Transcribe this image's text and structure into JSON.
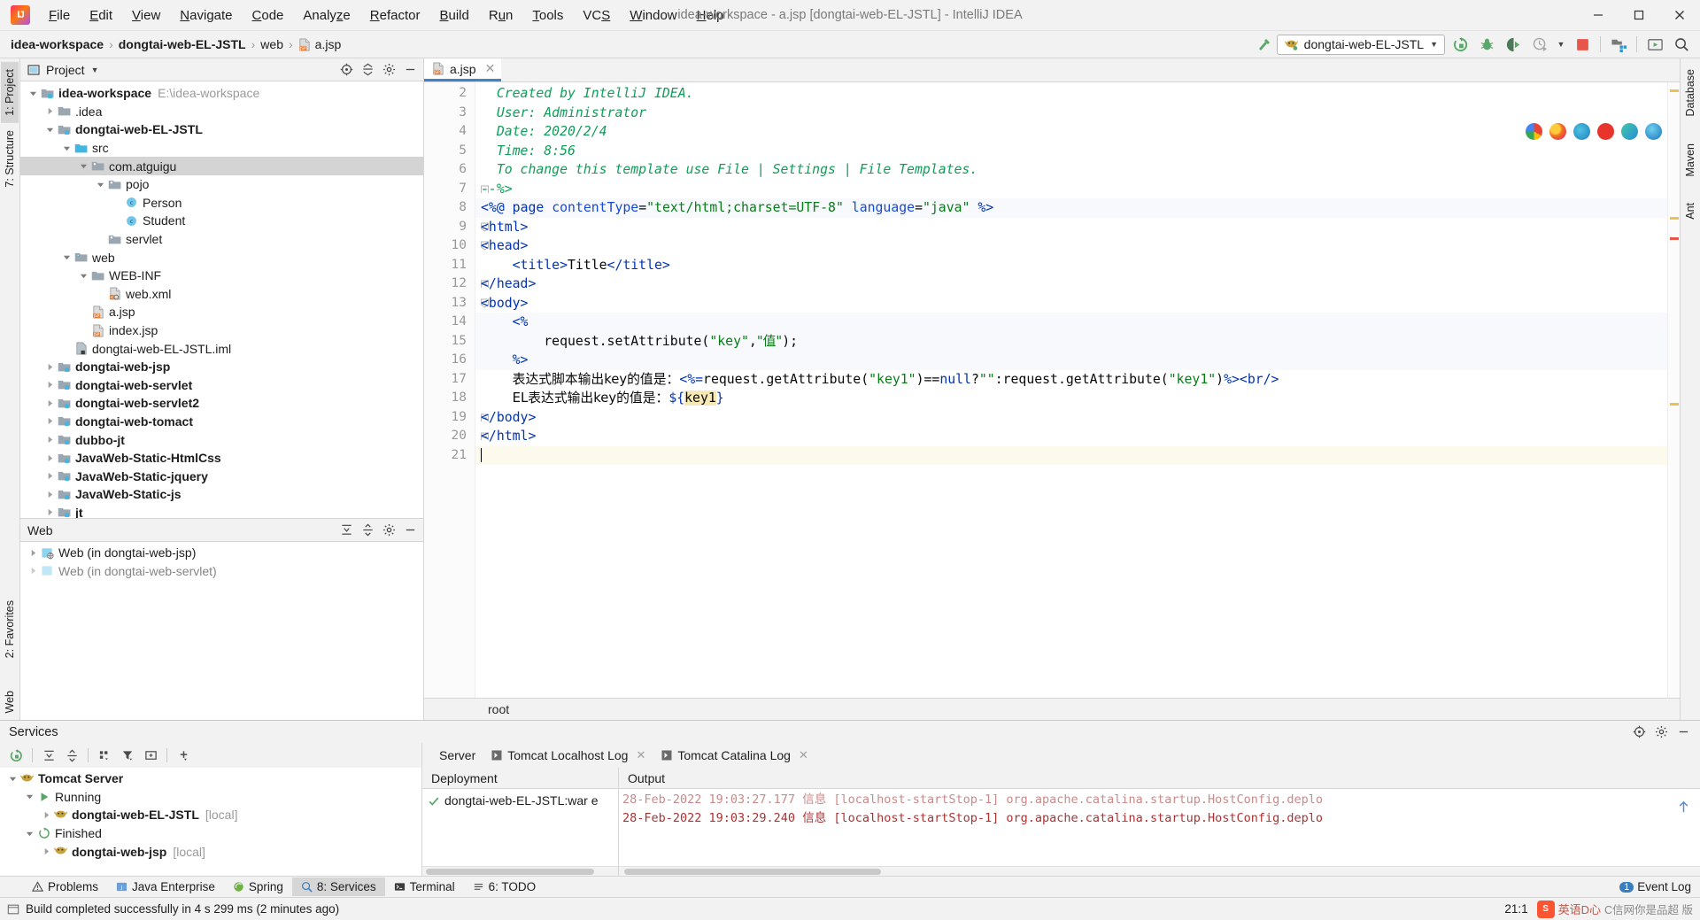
{
  "window": {
    "title": "idea-workspace - a.jsp [dongtai-web-EL-JSTL] - IntelliJ IDEA",
    "minimize": "—",
    "maximize": "❐",
    "close": "✕"
  },
  "menubar": [
    {
      "label": "File",
      "accel": "F"
    },
    {
      "label": "Edit",
      "accel": "E"
    },
    {
      "label": "View",
      "accel": "V"
    },
    {
      "label": "Navigate",
      "accel": "N"
    },
    {
      "label": "Code",
      "accel": "C"
    },
    {
      "label": "Analyze",
      "accel": "z"
    },
    {
      "label": "Refactor",
      "accel": "R"
    },
    {
      "label": "Build",
      "accel": "B"
    },
    {
      "label": "Run",
      "accel": "u"
    },
    {
      "label": "Tools",
      "accel": "T"
    },
    {
      "label": "VCS",
      "accel": "S"
    },
    {
      "label": "Window",
      "accel": "W"
    },
    {
      "label": "Help",
      "accel": "H"
    }
  ],
  "navbar": {
    "crumbs": [
      "idea-workspace",
      "dongtai-web-EL-JSTL",
      "web",
      "a.jsp"
    ],
    "run_config": "dongtai-web-EL-JSTL"
  },
  "left_strip": {
    "project_tab": "1: Project",
    "structure_tab": "7: Structure",
    "favorites_tab": "2: Favorites",
    "web_tab": "Web"
  },
  "right_strip": {
    "database_tab": "Database",
    "maven_tab": "Maven",
    "ant_tab": "Ant"
  },
  "project_panel": {
    "header": "Project",
    "tree": [
      {
        "depth": 0,
        "arrow": "down",
        "icon": "module",
        "label": "idea-workspace",
        "bold": true,
        "path": "E:\\idea-workspace",
        "selected": false
      },
      {
        "depth": 1,
        "arrow": "right",
        "icon": "folder",
        "label": ".idea",
        "bold": false,
        "path": "",
        "selected": false
      },
      {
        "depth": 1,
        "arrow": "down",
        "icon": "module",
        "label": "dongtai-web-EL-JSTL",
        "bold": true,
        "path": "",
        "selected": false
      },
      {
        "depth": 2,
        "arrow": "down",
        "icon": "src",
        "label": "src",
        "bold": false,
        "path": "",
        "selected": false
      },
      {
        "depth": 3,
        "arrow": "down",
        "icon": "package",
        "label": "com.atguigu",
        "bold": false,
        "path": "",
        "selected": true
      },
      {
        "depth": 4,
        "arrow": "down",
        "icon": "package",
        "label": "pojo",
        "bold": false,
        "path": "",
        "selected": false
      },
      {
        "depth": 5,
        "arrow": "none",
        "icon": "class",
        "label": "Person",
        "bold": false,
        "path": "",
        "selected": false
      },
      {
        "depth": 5,
        "arrow": "none",
        "icon": "class",
        "label": "Student",
        "bold": false,
        "path": "",
        "selected": false
      },
      {
        "depth": 4,
        "arrow": "none",
        "icon": "package",
        "label": "servlet",
        "bold": false,
        "path": "",
        "selected": false
      },
      {
        "depth": 2,
        "arrow": "down",
        "icon": "webroot",
        "label": "web",
        "bold": false,
        "path": "",
        "selected": false
      },
      {
        "depth": 3,
        "arrow": "down",
        "icon": "folder",
        "label": "WEB-INF",
        "bold": false,
        "path": "",
        "selected": false
      },
      {
        "depth": 4,
        "arrow": "none",
        "icon": "xml",
        "label": "web.xml",
        "bold": false,
        "path": "",
        "selected": false
      },
      {
        "depth": 3,
        "arrow": "none",
        "icon": "jsp",
        "label": "a.jsp",
        "bold": false,
        "path": "",
        "selected": false
      },
      {
        "depth": 3,
        "arrow": "none",
        "icon": "jsp",
        "label": "index.jsp",
        "bold": false,
        "path": "",
        "selected": false
      },
      {
        "depth": 2,
        "arrow": "none",
        "icon": "iml",
        "label": "dongtai-web-EL-JSTL.iml",
        "bold": false,
        "path": "",
        "selected": false
      },
      {
        "depth": 1,
        "arrow": "right",
        "icon": "module",
        "label": "dongtai-web-jsp",
        "bold": true,
        "path": "",
        "selected": false
      },
      {
        "depth": 1,
        "arrow": "right",
        "icon": "module",
        "label": "dongtai-web-servlet",
        "bold": true,
        "path": "",
        "selected": false
      },
      {
        "depth": 1,
        "arrow": "right",
        "icon": "module",
        "label": "dongtai-web-servlet2",
        "bold": true,
        "path": "",
        "selected": false
      },
      {
        "depth": 1,
        "arrow": "right",
        "icon": "module",
        "label": "dongtai-web-tomact",
        "bold": true,
        "path": "",
        "selected": false
      },
      {
        "depth": 1,
        "arrow": "right",
        "icon": "module",
        "label": "dubbo-jt",
        "bold": true,
        "path": "",
        "selected": false
      },
      {
        "depth": 1,
        "arrow": "right",
        "icon": "module",
        "label": "JavaWeb-Static-HtmlCss",
        "bold": true,
        "path": "",
        "selected": false
      },
      {
        "depth": 1,
        "arrow": "right",
        "icon": "module",
        "label": "JavaWeb-Static-jquery",
        "bold": true,
        "path": "",
        "selected": false
      },
      {
        "depth": 1,
        "arrow": "right",
        "icon": "module",
        "label": "JavaWeb-Static-js",
        "bold": true,
        "path": "",
        "selected": false
      },
      {
        "depth": 1,
        "arrow": "right",
        "icon": "module",
        "label": "jt",
        "bold": true,
        "path": "",
        "selected": false
      }
    ]
  },
  "web_panel": {
    "header": "Web",
    "items": [
      {
        "label": "Web (in dongtai-web-jsp)",
        "dim": false
      },
      {
        "label": "Web (in dongtai-web-servlet)",
        "dim": true
      }
    ]
  },
  "editor": {
    "tab": {
      "label": "a.jsp",
      "close": "✕"
    },
    "status_root": "root",
    "lines": [
      {
        "n": 2,
        "fold": "none",
        "hl": false
      },
      {
        "n": 3,
        "fold": "none",
        "hl": false
      },
      {
        "n": 4,
        "fold": "none",
        "hl": false
      },
      {
        "n": 5,
        "fold": "none",
        "hl": false
      },
      {
        "n": 6,
        "fold": "none",
        "hl": false
      },
      {
        "n": 7,
        "fold": "end",
        "hl": false
      },
      {
        "n": 8,
        "fold": "none",
        "hl": true
      },
      {
        "n": 9,
        "fold": "start",
        "hl": false
      },
      {
        "n": 10,
        "fold": "start",
        "hl": false
      },
      {
        "n": 11,
        "fold": "none",
        "hl": false
      },
      {
        "n": 12,
        "fold": "end",
        "hl": false
      },
      {
        "n": 13,
        "fold": "start",
        "hl": false
      },
      {
        "n": 14,
        "fold": "start",
        "hl": true
      },
      {
        "n": 15,
        "fold": "none",
        "hl": true
      },
      {
        "n": 16,
        "fold": "end",
        "hl": true
      },
      {
        "n": 17,
        "fold": "none",
        "hl": false
      },
      {
        "n": 18,
        "fold": "none",
        "hl": false
      },
      {
        "n": 19,
        "fold": "end",
        "hl": false
      },
      {
        "n": 20,
        "fold": "end",
        "hl": false
      },
      {
        "n": 21,
        "fold": "none",
        "hl": false
      }
    ],
    "code_text": [
      "  Created by IntelliJ IDEA.",
      "  User: Administrator",
      "  Date: 2020/2/4",
      "  Time: 8:56",
      "  To change this template use File | Settings | File Templates.",
      "--%>",
      "<%@ page contentType=\"text/html;charset=UTF-8\" language=\"java\" %>",
      "<html>",
      "<head>",
      "    <title>Title</title>",
      "</head>",
      "<body>",
      "    <%",
      "        request.setAttribute(\"key\",\"值\");",
      "    %>",
      "    表达式脚本输出key的值是：<%=request.getAttribute(\"key1\")==null?\"\":request.getAttribute(\"key1\")%><br/>",
      "    EL表达式输出key的值是：${key1}",
      "</body>",
      "</html>",
      ""
    ]
  },
  "services": {
    "header": "Services",
    "tree": [
      {
        "depth": 0,
        "arrow": "down",
        "icon": "tomcat",
        "label": "Tomcat Server",
        "bold": true,
        "dim": ""
      },
      {
        "depth": 1,
        "arrow": "down",
        "icon": "run",
        "label": "Running",
        "bold": false,
        "dim": ""
      },
      {
        "depth": 2,
        "arrow": "right",
        "icon": "tomcat",
        "label": "dongtai-web-EL-JSTL",
        "bold": true,
        "dim": "[local]"
      },
      {
        "depth": 1,
        "arrow": "down",
        "icon": "finished",
        "label": "Finished",
        "bold": false,
        "dim": ""
      },
      {
        "depth": 2,
        "arrow": "right",
        "icon": "tomcat",
        "label": "dongtai-web-jsp",
        "bold": true,
        "dim": "[local]"
      }
    ],
    "tabs": [
      {
        "label": "Server",
        "closable": false
      },
      {
        "label": "Tomcat Localhost Log",
        "closable": true
      },
      {
        "label": "Tomcat Catalina Log",
        "closable": true
      }
    ],
    "deployment_header": "Deployment",
    "deployment_item": "dongtai-web-EL-JSTL:war e",
    "output_header": "Output",
    "output_lines": [
      "28-Feb-2022 19:03:27.177 信息 [localhost-startStop-1] org.apache.catalina.startup.HostConfig.deplo",
      "28-Feb-2022 19:03:29.240 信息 [localhost-startStop-1] org.apache.catalina.startup.HostConfig.deplo"
    ]
  },
  "toolwindow_bar": {
    "items": [
      {
        "label": "Problems",
        "icon": "warning-icon",
        "selected": false
      },
      {
        "label": "Java Enterprise",
        "icon": "java-icon",
        "selected": false
      },
      {
        "label": "Spring",
        "icon": "spring-icon",
        "selected": false
      },
      {
        "label": "8: Services",
        "icon": "services-icon",
        "selected": true
      },
      {
        "label": "Terminal",
        "icon": "terminal-icon",
        "selected": false
      },
      {
        "label": "6: TODO",
        "icon": "todo-icon",
        "selected": false
      }
    ],
    "event_log": "Event Log",
    "event_count": "1"
  },
  "statusbar": {
    "build_message": "Build completed successfully in 4 s 299 ms (2 minutes ago)",
    "caret_position": "21:1",
    "watermark_brand": "英语D心",
    "watermark_text": "C信网你是品超 版"
  },
  "colors": {
    "accent_blue": "#4083c9",
    "green": "#59a869",
    "red_stop": "#e8564a",
    "keyword_blue": "#0033b3",
    "string_green": "#077d17",
    "comment_green": "#0f9d58",
    "el_highlight": "#f6e9b4"
  }
}
